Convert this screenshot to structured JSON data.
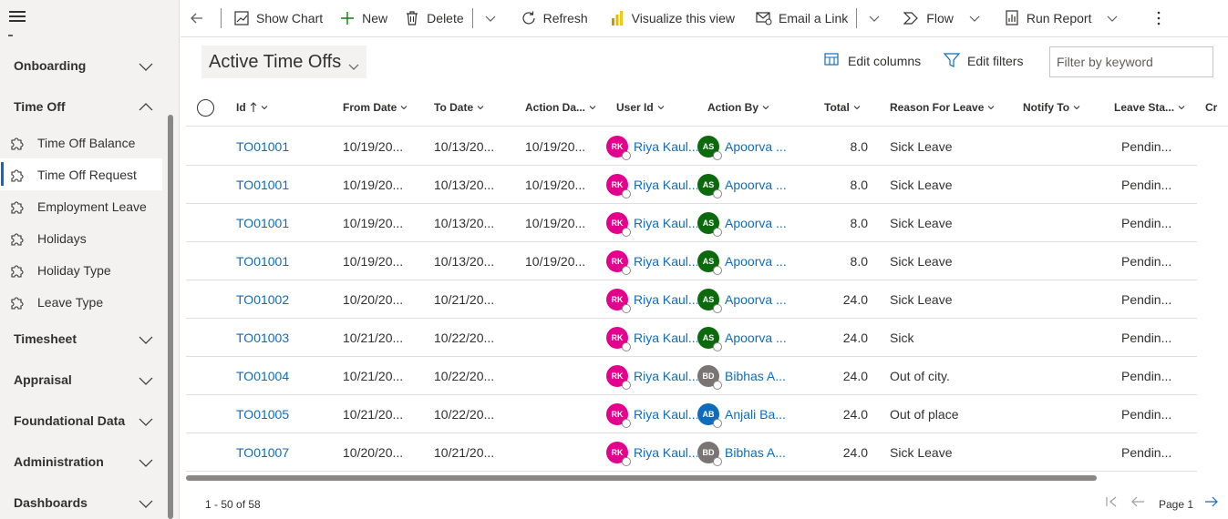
{
  "sidebar": {
    "groups": [
      {
        "label": "Onboarding",
        "expanded": false
      },
      {
        "label": "Time Off",
        "expanded": true
      },
      {
        "label": "Timesheet",
        "expanded": false
      },
      {
        "label": "Appraisal",
        "expanded": false
      },
      {
        "label": "Foundational Data",
        "expanded": false
      },
      {
        "label": "Administration",
        "expanded": false
      },
      {
        "label": "Dashboards",
        "expanded": false
      }
    ],
    "items": [
      {
        "label": "Time Off Balance",
        "icon": "puzzle-icon"
      },
      {
        "label": "Time Off Request",
        "icon": "puzzle-icon",
        "active": true
      },
      {
        "label": "Employment Leave",
        "icon": "puzzle-icon"
      },
      {
        "label": "Holidays",
        "icon": "puzzle-icon"
      },
      {
        "label": "Holiday Type",
        "icon": "puzzle-icon"
      },
      {
        "label": "Leave Type",
        "icon": "puzzle-icon"
      }
    ]
  },
  "toolbar": {
    "show_chart": "Show Chart",
    "new": "New",
    "delete": "Delete",
    "refresh": "Refresh",
    "visualize": "Visualize this view",
    "email_link": "Email a Link",
    "flow": "Flow",
    "run_report": "Run Report"
  },
  "view": {
    "title": "Active Time Offs",
    "edit_columns": "Edit columns",
    "edit_filters": "Edit filters",
    "filter_placeholder": "Filter by keyword"
  },
  "grid": {
    "columns": [
      "Id",
      "From Date",
      "To Date",
      "Action Da...",
      "User Id",
      "Action By",
      "Total",
      "Reason For Leave",
      "Notify To",
      "Leave Sta...",
      "Cr"
    ],
    "rows": [
      {
        "id": "TO01001",
        "from": "10/19/20...",
        "to": "10/13/20...",
        "action_date": "10/19/20...",
        "user_initials": "RK",
        "user": "Riya Kaul...",
        "by_initials": "AS",
        "by": "Apoorva ...",
        "by_color": "#0b6a0b",
        "total": "8.0",
        "reason": "Sick Leave",
        "status": "Pendin..."
      },
      {
        "id": "TO01001",
        "from": "10/19/20...",
        "to": "10/13/20...",
        "action_date": "10/19/20...",
        "user_initials": "RK",
        "user": "Riya Kaul...",
        "by_initials": "AS",
        "by": "Apoorva ...",
        "by_color": "#0b6a0b",
        "total": "8.0",
        "reason": "Sick Leave",
        "status": "Pendin..."
      },
      {
        "id": "TO01001",
        "from": "10/19/20...",
        "to": "10/13/20...",
        "action_date": "10/19/20...",
        "user_initials": "RK",
        "user": "Riya Kaul...",
        "by_initials": "AS",
        "by": "Apoorva ...",
        "by_color": "#0b6a0b",
        "total": "8.0",
        "reason": "Sick Leave",
        "status": "Pendin..."
      },
      {
        "id": "TO01001",
        "from": "10/19/20...",
        "to": "10/13/20...",
        "action_date": "10/19/20...",
        "user_initials": "RK",
        "user": "Riya Kaul...",
        "by_initials": "AS",
        "by": "Apoorva ...",
        "by_color": "#0b6a0b",
        "total": "8.0",
        "reason": "Sick Leave",
        "status": "Pendin..."
      },
      {
        "id": "TO01002",
        "from": "10/20/20...",
        "to": "10/21/20...",
        "action_date": "",
        "user_initials": "RK",
        "user": "Riya Kaul...",
        "by_initials": "AS",
        "by": "Apoorva ...",
        "by_color": "#0b6a0b",
        "total": "24.0",
        "reason": "Sick Leave",
        "status": "Pendin..."
      },
      {
        "id": "TO01003",
        "from": "10/21/20...",
        "to": "10/22/20...",
        "action_date": "",
        "user_initials": "RK",
        "user": "Riya Kaul...",
        "by_initials": "AS",
        "by": "Apoorva ...",
        "by_color": "#0b6a0b",
        "total": "24.0",
        "reason": "Sick",
        "status": "Pendin..."
      },
      {
        "id": "TO01004",
        "from": "10/21/20...",
        "to": "10/22/20...",
        "action_date": "",
        "user_initials": "RK",
        "user": "Riya Kaul...",
        "by_initials": "BD",
        "by": "Bibhas A...",
        "by_color": "#7a7574",
        "total": "24.0",
        "reason": "Out of city.",
        "status": "Pendin..."
      },
      {
        "id": "TO01005",
        "from": "10/21/20...",
        "to": "10/22/20...",
        "action_date": "",
        "user_initials": "RK",
        "user": "Riya Kaul...",
        "by_initials": "AB",
        "by": "Anjali Ba...",
        "by_color": "#0f6cbd",
        "total": "24.0",
        "reason": "Out of place",
        "status": "Pendin..."
      },
      {
        "id": "TO01007",
        "from": "10/20/20...",
        "to": "10/21/20...",
        "action_date": "",
        "user_initials": "RK",
        "user": "Riya Kaul...",
        "by_initials": "BD",
        "by": "Bibhas A...",
        "by_color": "#7a7574",
        "total": "24.0",
        "reason": "Sick Leave",
        "status": "Pendin..."
      }
    ],
    "user_color": "#e3008c"
  },
  "footer": {
    "count": "1 - 50 of 58",
    "page": "Page 1"
  }
}
